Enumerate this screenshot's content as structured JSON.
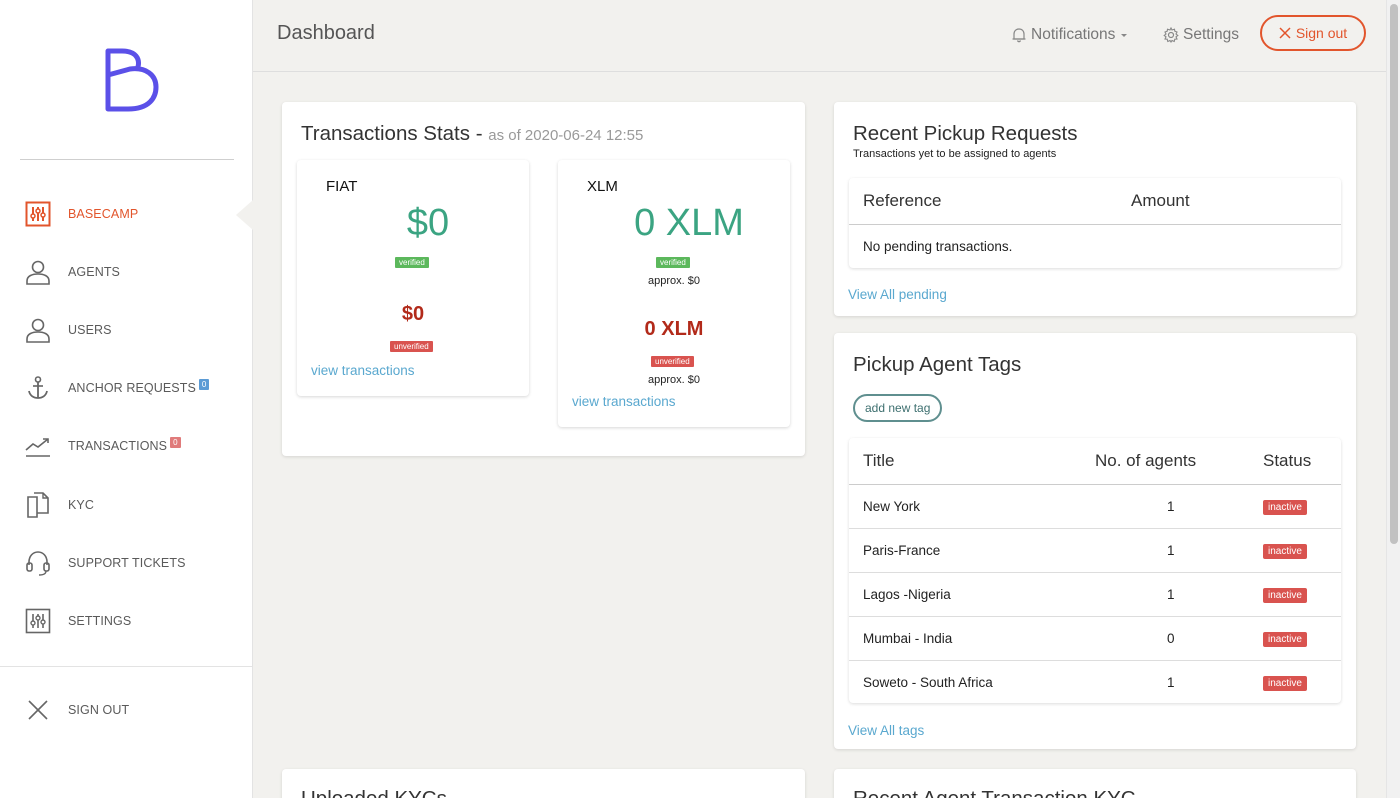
{
  "sidebar": {
    "items": [
      {
        "label": "BASECAMP",
        "icon": "sliders-icon",
        "active": true
      },
      {
        "label": "AGENTS",
        "icon": "user-icon"
      },
      {
        "label": "USERS",
        "icon": "user-icon"
      },
      {
        "label": "ANCHOR REQUESTS",
        "icon": "anchor-icon",
        "badge": "0"
      },
      {
        "label": "TRANSACTIONS",
        "icon": "trend-icon",
        "badge": "0"
      },
      {
        "label": "KYC",
        "icon": "documents-icon"
      },
      {
        "label": "SUPPORT TICKETS",
        "icon": "headset-icon"
      },
      {
        "label": "SETTINGS",
        "icon": "sliders-icon"
      }
    ],
    "signout_label": "SIGN OUT"
  },
  "header": {
    "title": "Dashboard",
    "notifications_label": "Notifications",
    "settings_label": "Settings",
    "signout_label": "Sign out"
  },
  "stats": {
    "title": "Transactions Stats -",
    "as_of": "as of 2020-06-24 12:55",
    "fiat": {
      "label": "FIAT",
      "verified_value": "$0",
      "verified_tag": "verified",
      "unverified_value": "$0",
      "unverified_tag": "unverified",
      "link": "view transactions"
    },
    "xlm": {
      "label": "XLM",
      "verified_value": "0 XLM",
      "verified_tag": "verified",
      "verified_approx": "approx. $0",
      "unverified_value": "0 XLM",
      "unverified_tag": "unverified",
      "unverified_approx": "approx. $0",
      "link": "view transactions"
    }
  },
  "pickup_requests": {
    "title": "Recent Pickup Requests",
    "subtitle": "Transactions yet to be assigned to agents",
    "columns": [
      "Reference",
      "Amount"
    ],
    "empty_text": "No pending transactions.",
    "link": "View All pending"
  },
  "agent_tags": {
    "title": "Pickup Agent Tags",
    "add_button": "add new tag",
    "columns": [
      "Title",
      "No. of agents",
      "Status"
    ],
    "rows": [
      {
        "title": "New York",
        "agents": "1",
        "status": "inactive"
      },
      {
        "title": "Paris-France",
        "agents": "1",
        "status": "inactive"
      },
      {
        "title": "Lagos -Nigeria",
        "agents": "1",
        "status": "inactive"
      },
      {
        "title": "Mumbai - India",
        "agents": "0",
        "status": "inactive"
      },
      {
        "title": "Soweto - South Africa",
        "agents": "1",
        "status": "inactive"
      }
    ],
    "link": "View All tags"
  },
  "bottom_cards": {
    "left_title": "Uploaded KYCs",
    "right_title": "Recent Agent Transaction KYC"
  },
  "colors": {
    "accent": "#e2552c",
    "verified": "#3ba482",
    "unverified": "#b22a1a",
    "link": "#5aa8cf",
    "logo": "#5b50e8"
  }
}
